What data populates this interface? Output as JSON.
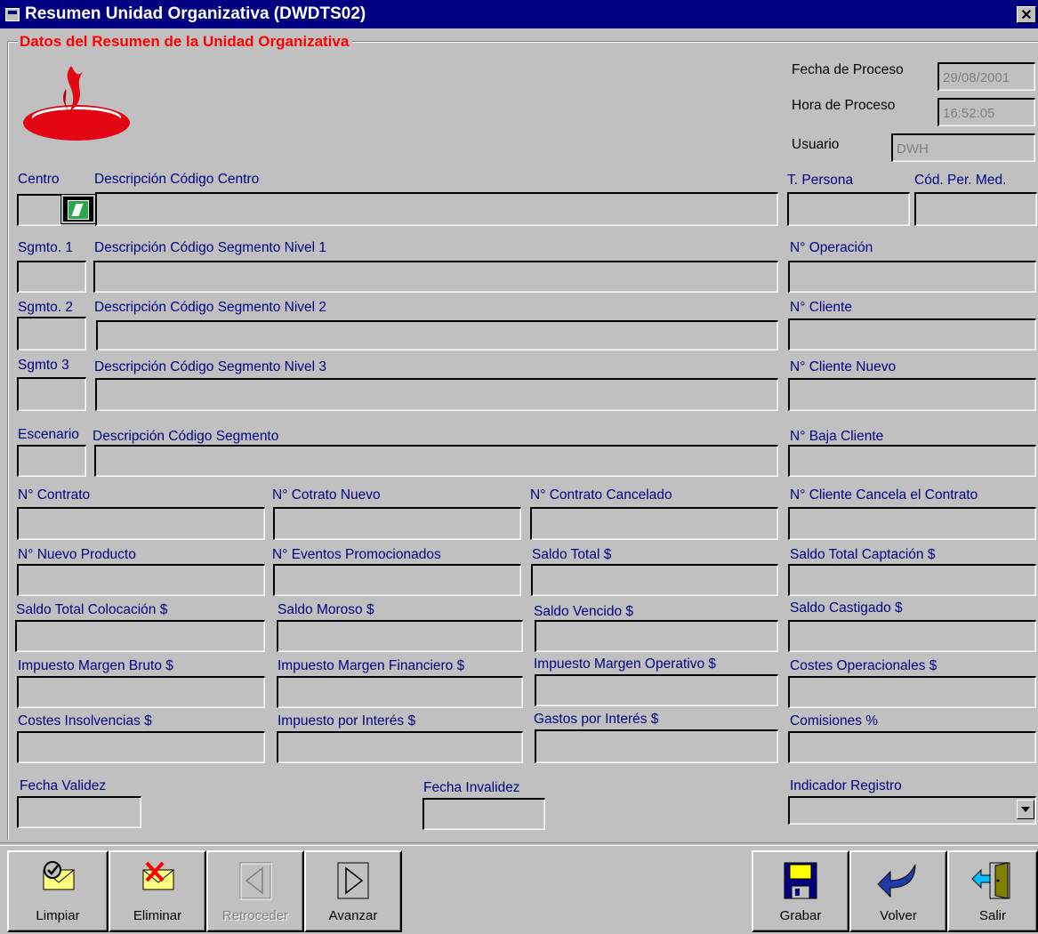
{
  "window": {
    "title": "Resumen Unidad Organizativa (DWDTS02)",
    "close_label": "✕"
  },
  "frame": {
    "legend": "Datos del Resumen de la Unidad Organizativa"
  },
  "process": {
    "fecha_label": "Fecha de Proceso",
    "fecha_value": "29/08/2001",
    "hora_label": "Hora de Proceso",
    "hora_value": "16:52:05",
    "usuario_label": "Usuario",
    "usuario_value": "DWH"
  },
  "labels": {
    "centro": "Centro",
    "desc_centro": "Descripción Código Centro",
    "t_persona": "T. Persona",
    "cod_per_med": "Cód. Per. Med.",
    "sgmto1": "Sgmto. 1",
    "desc_seg1": "Descripción Código Segmento Nivel 1",
    "n_operacion": "N° Operación",
    "sgmto2": "Sgmto. 2",
    "desc_seg2": "Descripción Código Segmento Nivel 2",
    "n_cliente": "N° Cliente",
    "sgmto3": "Sgmto 3",
    "desc_seg3": "Descripción Código Segmento Nivel 3",
    "n_cliente_nuevo": "N° Cliente Nuevo",
    "escenario": "Escenario",
    "desc_segmento": "Descripción Código Segmento",
    "n_baja_cliente": "N° Baja Cliente",
    "n_contrato": "N° Contrato",
    "n_cotrato_nuevo": "N° Cotrato Nuevo",
    "n_contrato_cancelado": "N° Contrato Cancelado",
    "n_cliente_cancela": "N° Cliente Cancela el Contrato",
    "n_nuevo_producto": "N° Nuevo Producto",
    "n_eventos": "N° Eventos Promocionados",
    "saldo_total": "Saldo Total $",
    "saldo_total_captacion": "Saldo Total Captación $",
    "saldo_total_colocacion": "Saldo Total Colocación $",
    "saldo_moroso": "Saldo Moroso $",
    "saldo_vencido": "Saldo Vencido $",
    "saldo_castigado": "Saldo Castigado $",
    "imp_margen_bruto": "Impuesto Margen Bruto $",
    "imp_margen_financiero": "Impuesto Margen Financiero $",
    "imp_margen_operativo": "Impuesto Margen Operativo $",
    "costes_operacionales": "Costes Operacionales $",
    "costes_insolvencias": "Costes Insolvencias $",
    "impuesto_interes": "Impuesto por Interés $",
    "gastos_interes": "Gastos por Interés $",
    "comisiones": "Comisiones %",
    "fecha_validez": "Fecha Validez",
    "fecha_invalidez": "Fecha Invalidez",
    "indicador_registro": "Indicador Registro"
  },
  "toolbar": {
    "limpiar": "Limpiar",
    "eliminar": "Eliminar",
    "retroceder": "Retroceder",
    "avanzar": "Avanzar",
    "grabar": "Grabar",
    "volver": "Volver",
    "salir": "Salir"
  },
  "icons": {
    "logo": "santander-flame-logo",
    "lookup": "lookup-icon",
    "limpiar": "envelope-check-icon",
    "eliminar": "envelope-x-icon",
    "retroceder": "arrow-left-icon",
    "avanzar": "arrow-right-icon",
    "grabar": "floppy-disk-icon",
    "volver": "return-arrow-icon",
    "salir": "exit-door-icon"
  },
  "colors": {
    "titlebar": "#000080",
    "legend": "#ff0000",
    "label": "#000080",
    "logo": "#e30613"
  }
}
